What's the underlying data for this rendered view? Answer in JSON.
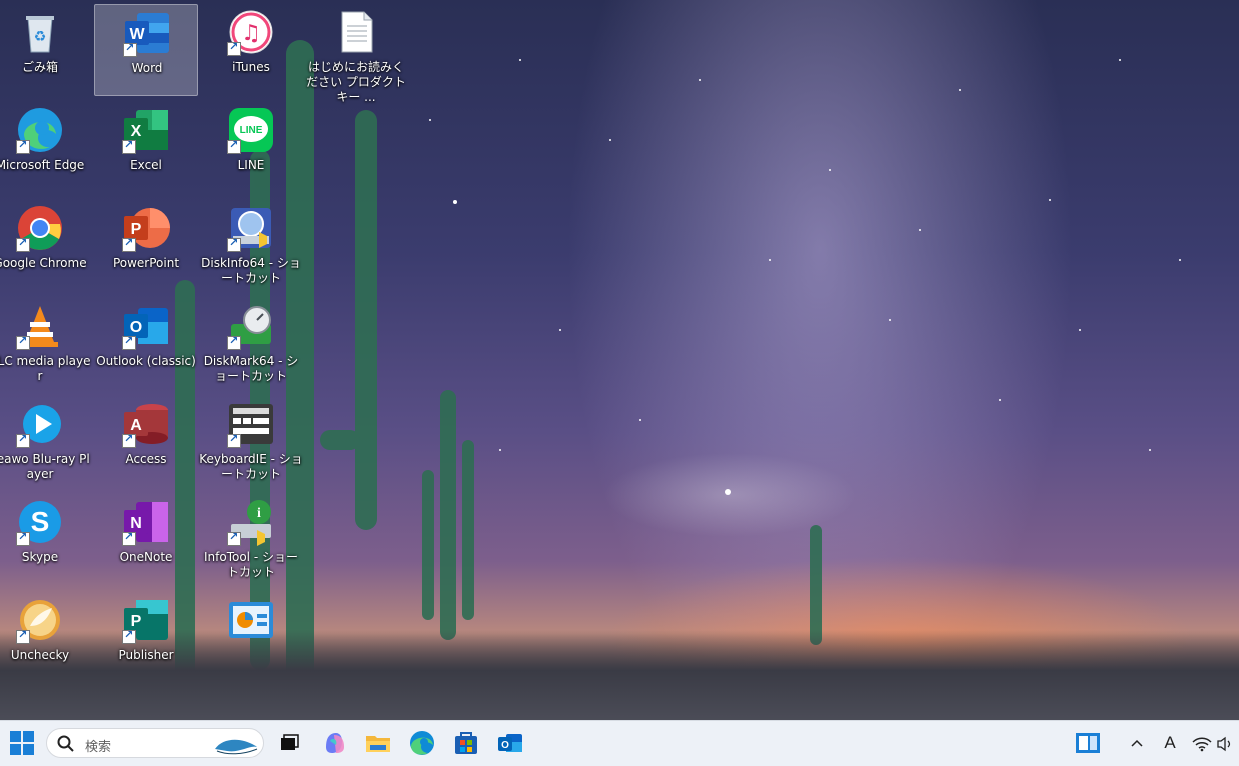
{
  "desktop": {
    "icons": [
      {
        "label": "ごみ箱",
        "icon": "recycle-bin-icon"
      },
      {
        "label": "Microsoft Edge",
        "icon": "edge-icon"
      },
      {
        "label": "Google Chrome",
        "icon": "chrome-icon"
      },
      {
        "label": "VLC media player",
        "icon": "vlc-icon"
      },
      {
        "label": "Leawo Blu-ray Player",
        "icon": "leawo-icon"
      },
      {
        "label": "Skype",
        "icon": "skype-icon"
      },
      {
        "label": "Unchecky",
        "icon": "unchecky-icon"
      },
      {
        "label": "Word",
        "icon": "word-icon"
      },
      {
        "label": "Excel",
        "icon": "excel-icon"
      },
      {
        "label": "PowerPoint",
        "icon": "powerpoint-icon"
      },
      {
        "label": "Outlook (classic)",
        "icon": "outlook-icon"
      },
      {
        "label": "Access",
        "icon": "access-icon"
      },
      {
        "label": "OneNote",
        "icon": "onenote-icon"
      },
      {
        "label": "Publisher",
        "icon": "publisher-icon"
      },
      {
        "label": "iTunes",
        "icon": "itunes-icon"
      },
      {
        "label": "LINE",
        "icon": "line-icon"
      },
      {
        "label": "DiskInfo64 - ショートカット",
        "icon": "diskinfo-icon"
      },
      {
        "label": "DiskMark64 - ショートカット",
        "icon": "diskmark-icon"
      },
      {
        "label": "KeyboardIE - ショートカット",
        "icon": "keyboardie-icon"
      },
      {
        "label": "InfoTool - ショートカット",
        "icon": "infotool-icon"
      },
      {
        "label": "",
        "icon": "control-panel-icon"
      },
      {
        "label": "はじめにお読みください プロダクトキー ...",
        "icon": "text-document-icon"
      }
    ],
    "selected": "Word"
  },
  "taskbar": {
    "search_placeholder": "検索",
    "ime_indicator": "A",
    "colors": {
      "edge": "#0f8bd6",
      "outlook": "#0a64c8",
      "explorer": "#f4b73b",
      "start": "#1a7fd6"
    }
  }
}
